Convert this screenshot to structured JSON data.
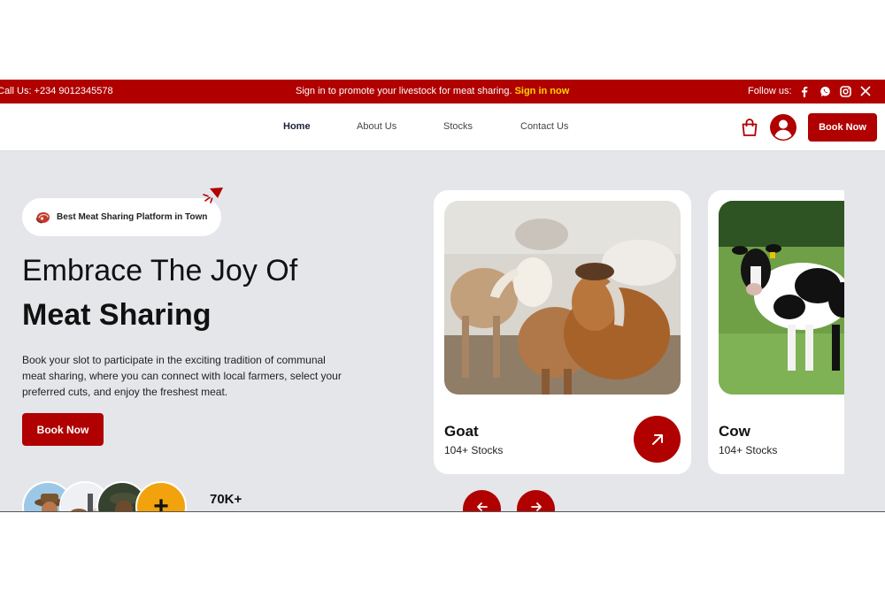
{
  "topbar": {
    "call_text": "Call Us: +234 9012345578",
    "promo_text": "Sign in to promote your livestock for meat sharing.",
    "promo_link": "Sign in now",
    "follow_label": "Follow us:",
    "social_icons": [
      "facebook-icon",
      "whatsapp-icon",
      "instagram-icon",
      "x-icon"
    ]
  },
  "nav": {
    "links": [
      "Home",
      "About Us",
      "Stocks",
      "Contact Us"
    ],
    "active": "Home",
    "book_label": "Book Now"
  },
  "hero": {
    "badge": "Best Meat Sharing Platform in Town",
    "title_line1": "Embrace The Joy Of",
    "title_line2": "Meat Sharing",
    "description": "Book your slot to participate in the exciting tradition of communal meat sharing, where you can connect with local farmers, select your preferred cuts, and enjoy the freshest meat.",
    "book_label": "Book Now",
    "stat": "70K+",
    "plus": "+"
  },
  "cards": [
    {
      "name": "Goat",
      "stocks": "104+ Stocks"
    },
    {
      "name": "Cow",
      "stocks": "104+ Stocks"
    }
  ],
  "colors": {
    "brand": "#b00000",
    "highlight": "#ffd400",
    "background": "#e5e6ea",
    "plus_circle": "#f2a20c"
  }
}
